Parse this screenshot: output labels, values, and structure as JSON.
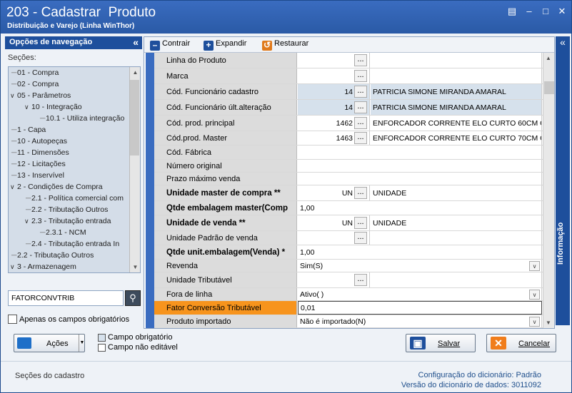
{
  "window": {
    "title": "203 - Cadastrar  Produto",
    "subtitle": "Distribuição e Varejo (Linha WinThor)"
  },
  "nav": {
    "header": "Opções de navegação",
    "sections_label": "Seções:",
    "tree": [
      {
        "label": "01 - Compra",
        "indent": 0,
        "toggle": ""
      },
      {
        "label": "02 - Compra",
        "indent": 0,
        "toggle": ""
      },
      {
        "label": "05 - Parâmetros",
        "indent": 0,
        "toggle": "v"
      },
      {
        "label": "10 - Integração",
        "indent": 1,
        "toggle": "v"
      },
      {
        "label": "10.1 - Utiliza integração",
        "indent": 2,
        "toggle": ""
      },
      {
        "label": "1 - Capa",
        "indent": 0,
        "toggle": ""
      },
      {
        "label": "10 - Autopeças",
        "indent": 0,
        "toggle": ""
      },
      {
        "label": "11 - Dimensões",
        "indent": 0,
        "toggle": ""
      },
      {
        "label": "12 - Licitações",
        "indent": 0,
        "toggle": ""
      },
      {
        "label": "13 - Inservível",
        "indent": 0,
        "toggle": ""
      },
      {
        "label": "2 - Condições de Compra",
        "indent": 0,
        "toggle": "v"
      },
      {
        "label": "2.1 - Política comercial com",
        "indent": 1,
        "toggle": ""
      },
      {
        "label": "2.2 - Tributação Outros",
        "indent": 1,
        "toggle": ""
      },
      {
        "label": "2.3 - Tributação entrada",
        "indent": 1,
        "toggle": "v"
      },
      {
        "label": "2.3.1 - NCM",
        "indent": 2,
        "toggle": ""
      },
      {
        "label": "2.4 - Tributação entrada In",
        "indent": 1,
        "toggle": ""
      },
      {
        "label": "2.2 - Tributação Outros",
        "indent": 0,
        "toggle": ""
      },
      {
        "label": "3 - Armazenagem",
        "indent": 0,
        "toggle": "v"
      }
    ],
    "search_value": "FATORCONVTRIB",
    "only_required_label": "Apenas os campos obrigatórios"
  },
  "toolbar": {
    "contrair": "Contrair",
    "expandir": "Expandir",
    "restaurar": "Restaurar"
  },
  "grid": [
    {
      "label": "Linha do Produto",
      "bold": false,
      "code": "",
      "ellipsis": true,
      "desc": "",
      "gray": false,
      "dropdown": false
    },
    {
      "label": "Marca",
      "bold": false,
      "code": "",
      "ellipsis": true,
      "desc": "",
      "gray": false,
      "dropdown": false
    },
    {
      "label": "Cód. Funcionário cadastro",
      "bold": false,
      "code": "14",
      "ellipsis": true,
      "desc": "PATRICIA SIMONE MIRANDA AMARAL",
      "gray": true,
      "dropdown": false
    },
    {
      "label": "Cód. Funcionário últ.alteração",
      "bold": false,
      "code": "14",
      "ellipsis": true,
      "desc": "PATRICIA SIMONE MIRANDA AMARAL",
      "gray": true,
      "dropdown": false
    },
    {
      "label": "Cód. prod. principal",
      "bold": false,
      "code": "1462",
      "ellipsis": true,
      "desc": "ENFORCADOR CORRENTE ELO CURTO 60CM GP",
      "gray": false,
      "dropdown": false
    },
    {
      "label": "Cód.prod. Master",
      "bold": false,
      "code": "1463",
      "ellipsis": true,
      "desc": "ENFORCADOR CORRENTE ELO CURTO 70CM GP",
      "gray": false,
      "dropdown": false
    },
    {
      "label": "Cód. Fábrica",
      "bold": false,
      "value": ""
    },
    {
      "label": "Número original",
      "bold": false,
      "value": ""
    },
    {
      "label": "Prazo máximo venda",
      "bold": false,
      "value": ""
    },
    {
      "label": "Unidade master de compra **",
      "bold": true,
      "code": "UN",
      "ellipsis": true,
      "desc": "UNIDADE",
      "gray": false,
      "dropdown": false
    },
    {
      "label": "Qtde embalagem master(Comp",
      "bold": true,
      "value": "1,00"
    },
    {
      "label": "Unidade de venda **",
      "bold": true,
      "code": "UN",
      "ellipsis": true,
      "desc": "UNIDADE",
      "gray": false,
      "dropdown": false
    },
    {
      "label": "Unidade Padrão de venda",
      "bold": false,
      "code": "",
      "ellipsis": true,
      "desc": "",
      "gray": false,
      "dropdown": false
    },
    {
      "label": "Qtde unit.embalagem(Venda) *",
      "bold": true,
      "value": "1,00"
    },
    {
      "label": "Revenda",
      "bold": false,
      "value": "Sim(S)",
      "dropdown": true
    },
    {
      "label": "Unidade Tributável",
      "bold": false,
      "code": "",
      "ellipsis": true,
      "desc": "",
      "gray": false,
      "dropdown": false
    },
    {
      "label": "Fora de linha",
      "bold": false,
      "value": "Ativo( )",
      "dropdown": true
    },
    {
      "label": "Fator Conversão Tributável",
      "bold": false,
      "value": "0,01",
      "highlight": true
    },
    {
      "label": "Produto importado",
      "bold": false,
      "value": "Não é importado(N)",
      "dropdown": true
    }
  ],
  "info_panel": "Informação",
  "buttons": {
    "acoes": "Ações",
    "salvar": "Salvar",
    "cancelar": "Cancelar"
  },
  "legend": {
    "required": "Campo obrigatório",
    "not_editable": "Campo não editável"
  },
  "status": {
    "sections": "Seções do cadastro",
    "config_label": "Configuração do dicionário:",
    "config_value": "Padrão",
    "version_label": "Versão do dicionário de dados:",
    "version_value": "3011092"
  },
  "colors": {
    "title_bar": "#2a5aa6",
    "highlight_row": "#f7941d",
    "nav_header": "#1e4f9c"
  }
}
